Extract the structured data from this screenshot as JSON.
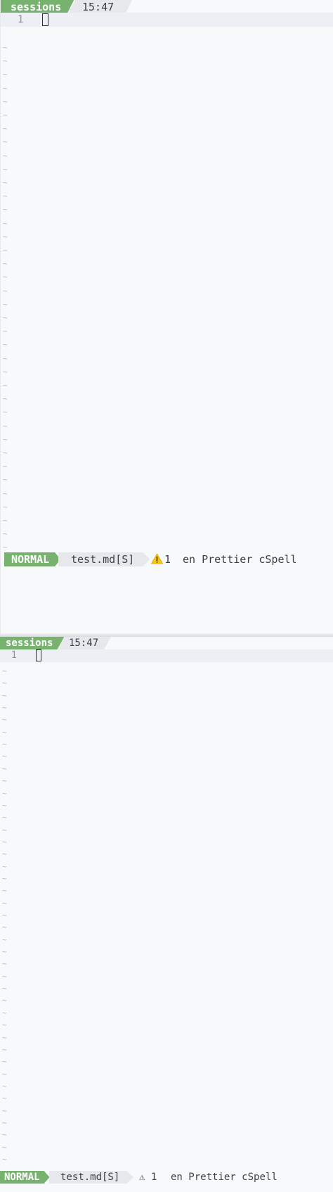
{
  "panes": [
    {
      "tabline": {
        "session_label": "sessions",
        "time": "15:47"
      },
      "line_number": "1",
      "tilde": "~",
      "statusline": {
        "mode": "NORMAL",
        "file": "test.md[S]",
        "warning_icon": "warning-triangle-emoji",
        "warning_count": "1",
        "language": "en",
        "formatter": "Prettier",
        "spellchecker": "cSpell"
      }
    },
    {
      "tabline": {
        "session_label": "sessions",
        "time": "15:47"
      },
      "line_number": "1",
      "tilde": "~",
      "statusline": {
        "mode": "NORMAL",
        "file": "test.md[S]",
        "warning_icon": "warning-triangle-glyph",
        "warning_symbol": "⚠",
        "warning_count": "1",
        "language": "en",
        "formatter": "Prettier",
        "spellchecker": "cSpell"
      }
    }
  ],
  "colors": {
    "mode_green": "#77b26f",
    "tab_gray": "#e6e8ec",
    "background": "#f8f9fa",
    "warning_yellow": "#f5c518"
  }
}
